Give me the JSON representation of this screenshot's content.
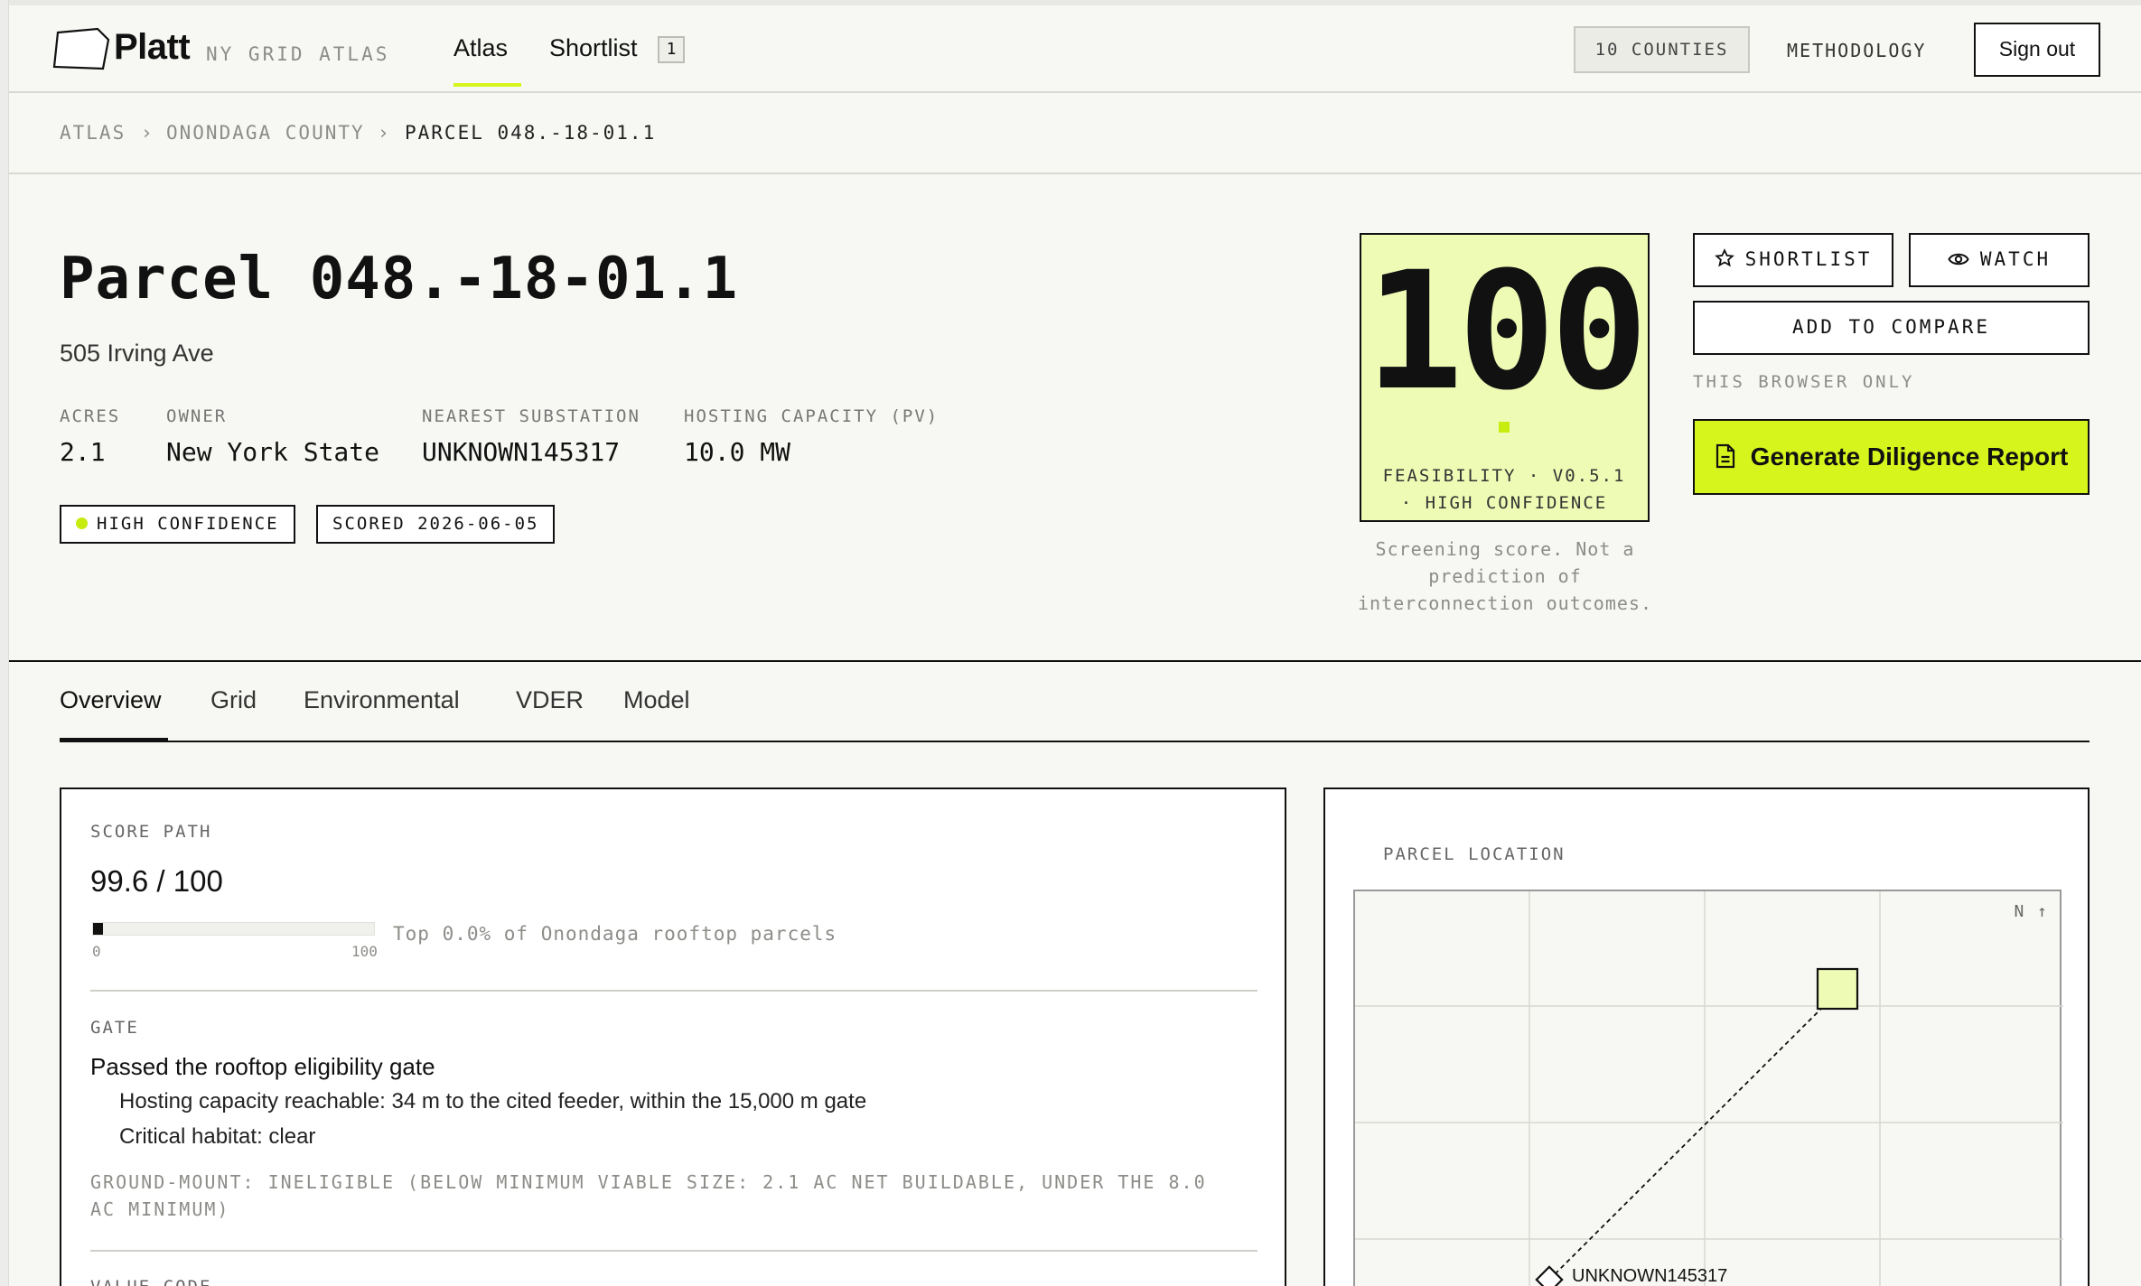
{
  "header": {
    "brand": "Platt",
    "brand_sub": "NY GRID ATLAS",
    "nav": {
      "atlas": "Atlas",
      "shortlist": "Shortlist",
      "shortlist_count": "1"
    },
    "counties": "10 COUNTIES",
    "methodology": "METHODOLOGY",
    "sign_out": "Sign out"
  },
  "breadcrumb": {
    "root": "ATLAS",
    "county": "ONONDAGA COUNTY",
    "parcel": "PARCEL 048.-18-01.1",
    "separator": "›"
  },
  "parcel": {
    "title": "Parcel 048.-18-01.1",
    "address": "505 Irving Ave",
    "stats": [
      {
        "label": "ACRES",
        "value": "2.1"
      },
      {
        "label": "OWNER",
        "value": "New York State"
      },
      {
        "label": "NEAREST SUBSTATION",
        "value": "UNKNOWN145317"
      },
      {
        "label": "HOSTING CAPACITY (PV)",
        "value": "10.0 MW"
      }
    ],
    "pills": {
      "confidence": "HIGH CONFIDENCE",
      "scored": "SCORED 2026-06-05"
    }
  },
  "score": {
    "value": "100",
    "footer_line1": "FEASIBILITY · V0.5.1",
    "footer_line2": "· HIGH CONFIDENCE",
    "note_line1": "Screening score. Not a",
    "note_line2": "prediction of",
    "note_line3": "interconnection outcomes."
  },
  "actions": {
    "shortlist": "SHORTLIST",
    "watch": "WATCH",
    "compare": "ADD TO COMPARE",
    "browser_only": "THIS BROWSER ONLY",
    "generate": "Generate Diligence Report"
  },
  "tabs": [
    "Overview",
    "Grid",
    "Environmental",
    "VDER",
    "Model"
  ],
  "overview": {
    "score_path_label": "SCORE PATH",
    "score_path_value": "99.6 / 100",
    "score_fraction": 0.996,
    "bar_min": "0",
    "bar_max": "100",
    "bar_caption": "Top 0.0% of Onondaga rooftop parcels",
    "gate_label": "GATE",
    "gate_title": "Passed the rooftop eligibility gate",
    "gate_items": [
      "Hosting capacity reachable: 34 m to the cited feeder, within the 15,000 m gate",
      "Critical habitat: clear"
    ],
    "gate_note": "GROUND-MOUNT: INELIGIBLE (BELOW MINIMUM VIABLE SIZE: 2.1 AC NET BUILDABLE, UNDER THE 8.0 AC MINIMUM)",
    "value_code_label": "VALUE CODE"
  },
  "location": {
    "label": "PARCEL LOCATION",
    "north": "N ↑",
    "substation_label": "UNKNOWN145317"
  },
  "colors": {
    "accent": "#d6f51d",
    "score_bg": "#eefbb4",
    "ink": "#111111"
  }
}
